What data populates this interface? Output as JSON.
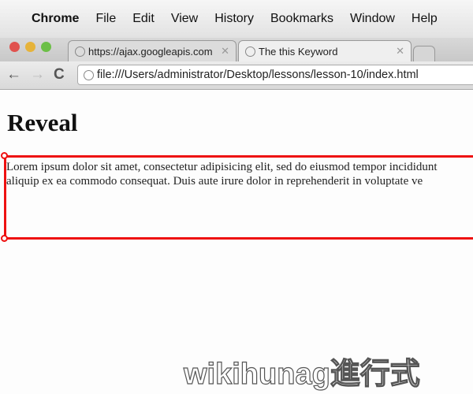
{
  "menubar": {
    "app": "Chrome",
    "items": [
      "File",
      "Edit",
      "View",
      "History",
      "Bookmarks",
      "Window",
      "Help"
    ]
  },
  "tabs": [
    {
      "title": "https://ajax.googleapis.com"
    },
    {
      "title": "The this Keyword"
    }
  ],
  "toolbar": {
    "url": "file:///Users/administrator/Desktop/lessons/lesson-10/index.html"
  },
  "page": {
    "heading": "Reveal",
    "lines": [
      "Lorem ipsum dolor sit amet, consectetur adipisicing elit, sed do eiusmod tempor incididunt",
      "aliquip ex ea commodo consequat. Duis aute irure dolor in reprehenderit in voluptate ve"
    ]
  },
  "watermark": "wikihunag進行式",
  "colors": {
    "highlight": "#e11111"
  }
}
